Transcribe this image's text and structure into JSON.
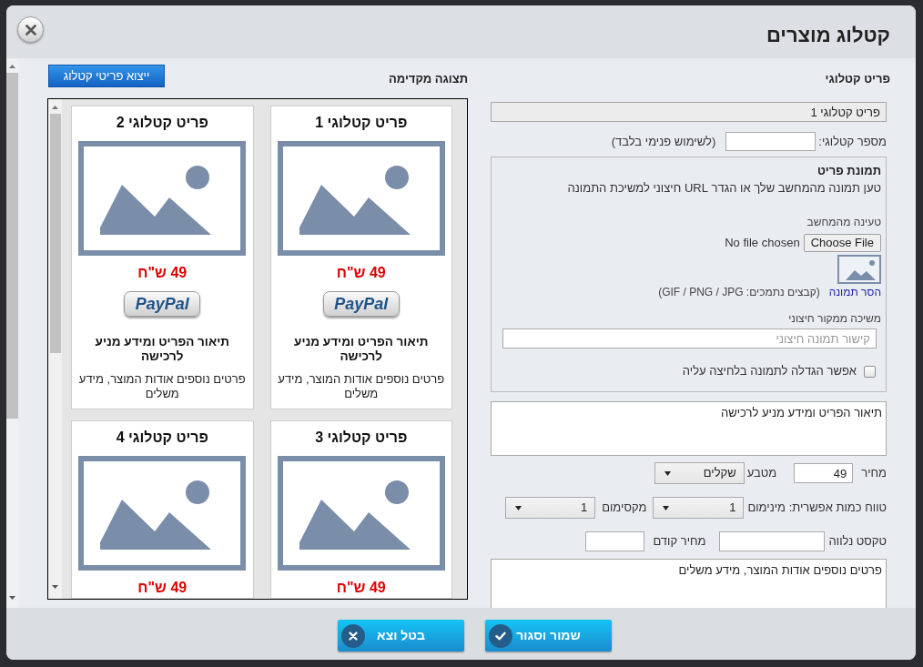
{
  "dialog": {
    "title": "קטלוג מוצרים"
  },
  "form": {
    "heading": "פריט קטלוגי",
    "item_name": {
      "value": "פריט קטלוגי 1"
    },
    "catalog_number": {
      "label": "מספר קטלוגי:",
      "note": "(לשימוש פנימי בלבד)"
    },
    "image": {
      "heading": "תמונת פריט",
      "hint": "טען תמונה מהמחשב שלך או הגדר URL חיצוני למשיכת התמונה",
      "upload_label": "טעינה מהמחשב",
      "file_button": "Choose File",
      "file_status": "No file chosen",
      "remove_link": "הסר תמונה",
      "formats": "(קבצים נתמכים: GIF / PNG / JPG)",
      "external_label": "משיכה ממקור חיצוני",
      "external_url": {
        "placeholder": "קישור תמונה חיצוני"
      },
      "zoom_option": {
        "label": "אפשר הגדלה לתמונה בלחיצה עליה",
        "checked": false
      }
    },
    "description": {
      "value": "תיאור הפריט ומידע מניע לרכישה"
    },
    "price": {
      "label": "מחיר",
      "value": "49"
    },
    "currency": {
      "label": "מטבע",
      "value": "שקלים"
    },
    "quantity": {
      "label": "טווח כמות אפשרית: מינימום",
      "min": "1",
      "max_label": "מקסימום",
      "max": "1"
    },
    "companion_text": {
      "label": "טקסט נלווה"
    },
    "old_price": {
      "label": "מחיר קודם"
    },
    "details": {
      "value": "פרטים נוספים אודות המוצר, מידע משלים"
    }
  },
  "preview": {
    "heading": "תצוגה מקדימה",
    "export_button": "ייצוא פריטי קטלוג",
    "cards": [
      {
        "title": "פריט קטלוגי 1",
        "price": "49 ש\"ח",
        "buy_button": "PayPal",
        "description": "תיאור הפריט ומידע מניע לרכישה",
        "details": "פרטים נוספים אודות המוצר, מידע משלים"
      },
      {
        "title": "פריט קטלוגי 2",
        "price": "49 ש\"ח",
        "buy_button": "PayPal",
        "description": "תיאור הפריט ומידע מניע לרכישה",
        "details": "פרטים נוספים אודות המוצר, מידע משלים"
      },
      {
        "title": "פריט קטלוגי 3",
        "price": "49 ש\"ח"
      },
      {
        "title": "פריט קטלוגי 4",
        "price": "49 ש\"ח"
      }
    ]
  },
  "footer": {
    "buttons": [
      {
        "label": "שמור וסגור",
        "kind": "save"
      },
      {
        "label": "בטל וצא",
        "kind": "cancel"
      }
    ]
  }
}
